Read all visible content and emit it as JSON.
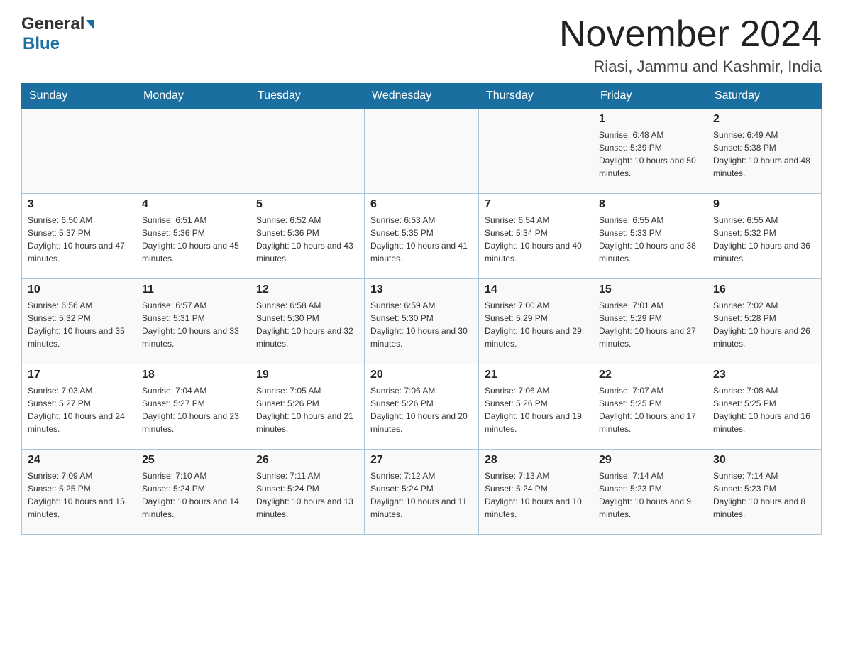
{
  "header": {
    "logo_general": "General",
    "logo_blue": "Blue",
    "month_title": "November 2024",
    "location": "Riasi, Jammu and Kashmir, India"
  },
  "days_of_week": [
    "Sunday",
    "Monday",
    "Tuesday",
    "Wednesday",
    "Thursday",
    "Friday",
    "Saturday"
  ],
  "weeks": [
    [
      {
        "day": "",
        "sunrise": "",
        "sunset": "",
        "daylight": ""
      },
      {
        "day": "",
        "sunrise": "",
        "sunset": "",
        "daylight": ""
      },
      {
        "day": "",
        "sunrise": "",
        "sunset": "",
        "daylight": ""
      },
      {
        "day": "",
        "sunrise": "",
        "sunset": "",
        "daylight": ""
      },
      {
        "day": "",
        "sunrise": "",
        "sunset": "",
        "daylight": ""
      },
      {
        "day": "1",
        "sunrise": "Sunrise: 6:48 AM",
        "sunset": "Sunset: 5:39 PM",
        "daylight": "Daylight: 10 hours and 50 minutes."
      },
      {
        "day": "2",
        "sunrise": "Sunrise: 6:49 AM",
        "sunset": "Sunset: 5:38 PM",
        "daylight": "Daylight: 10 hours and 48 minutes."
      }
    ],
    [
      {
        "day": "3",
        "sunrise": "Sunrise: 6:50 AM",
        "sunset": "Sunset: 5:37 PM",
        "daylight": "Daylight: 10 hours and 47 minutes."
      },
      {
        "day": "4",
        "sunrise": "Sunrise: 6:51 AM",
        "sunset": "Sunset: 5:36 PM",
        "daylight": "Daylight: 10 hours and 45 minutes."
      },
      {
        "day": "5",
        "sunrise": "Sunrise: 6:52 AM",
        "sunset": "Sunset: 5:36 PM",
        "daylight": "Daylight: 10 hours and 43 minutes."
      },
      {
        "day": "6",
        "sunrise": "Sunrise: 6:53 AM",
        "sunset": "Sunset: 5:35 PM",
        "daylight": "Daylight: 10 hours and 41 minutes."
      },
      {
        "day": "7",
        "sunrise": "Sunrise: 6:54 AM",
        "sunset": "Sunset: 5:34 PM",
        "daylight": "Daylight: 10 hours and 40 minutes."
      },
      {
        "day": "8",
        "sunrise": "Sunrise: 6:55 AM",
        "sunset": "Sunset: 5:33 PM",
        "daylight": "Daylight: 10 hours and 38 minutes."
      },
      {
        "day": "9",
        "sunrise": "Sunrise: 6:55 AM",
        "sunset": "Sunset: 5:32 PM",
        "daylight": "Daylight: 10 hours and 36 minutes."
      }
    ],
    [
      {
        "day": "10",
        "sunrise": "Sunrise: 6:56 AM",
        "sunset": "Sunset: 5:32 PM",
        "daylight": "Daylight: 10 hours and 35 minutes."
      },
      {
        "day": "11",
        "sunrise": "Sunrise: 6:57 AM",
        "sunset": "Sunset: 5:31 PM",
        "daylight": "Daylight: 10 hours and 33 minutes."
      },
      {
        "day": "12",
        "sunrise": "Sunrise: 6:58 AM",
        "sunset": "Sunset: 5:30 PM",
        "daylight": "Daylight: 10 hours and 32 minutes."
      },
      {
        "day": "13",
        "sunrise": "Sunrise: 6:59 AM",
        "sunset": "Sunset: 5:30 PM",
        "daylight": "Daylight: 10 hours and 30 minutes."
      },
      {
        "day": "14",
        "sunrise": "Sunrise: 7:00 AM",
        "sunset": "Sunset: 5:29 PM",
        "daylight": "Daylight: 10 hours and 29 minutes."
      },
      {
        "day": "15",
        "sunrise": "Sunrise: 7:01 AM",
        "sunset": "Sunset: 5:29 PM",
        "daylight": "Daylight: 10 hours and 27 minutes."
      },
      {
        "day": "16",
        "sunrise": "Sunrise: 7:02 AM",
        "sunset": "Sunset: 5:28 PM",
        "daylight": "Daylight: 10 hours and 26 minutes."
      }
    ],
    [
      {
        "day": "17",
        "sunrise": "Sunrise: 7:03 AM",
        "sunset": "Sunset: 5:27 PM",
        "daylight": "Daylight: 10 hours and 24 minutes."
      },
      {
        "day": "18",
        "sunrise": "Sunrise: 7:04 AM",
        "sunset": "Sunset: 5:27 PM",
        "daylight": "Daylight: 10 hours and 23 minutes."
      },
      {
        "day": "19",
        "sunrise": "Sunrise: 7:05 AM",
        "sunset": "Sunset: 5:26 PM",
        "daylight": "Daylight: 10 hours and 21 minutes."
      },
      {
        "day": "20",
        "sunrise": "Sunrise: 7:06 AM",
        "sunset": "Sunset: 5:26 PM",
        "daylight": "Daylight: 10 hours and 20 minutes."
      },
      {
        "day": "21",
        "sunrise": "Sunrise: 7:06 AM",
        "sunset": "Sunset: 5:26 PM",
        "daylight": "Daylight: 10 hours and 19 minutes."
      },
      {
        "day": "22",
        "sunrise": "Sunrise: 7:07 AM",
        "sunset": "Sunset: 5:25 PM",
        "daylight": "Daylight: 10 hours and 17 minutes."
      },
      {
        "day": "23",
        "sunrise": "Sunrise: 7:08 AM",
        "sunset": "Sunset: 5:25 PM",
        "daylight": "Daylight: 10 hours and 16 minutes."
      }
    ],
    [
      {
        "day": "24",
        "sunrise": "Sunrise: 7:09 AM",
        "sunset": "Sunset: 5:25 PM",
        "daylight": "Daylight: 10 hours and 15 minutes."
      },
      {
        "day": "25",
        "sunrise": "Sunrise: 7:10 AM",
        "sunset": "Sunset: 5:24 PM",
        "daylight": "Daylight: 10 hours and 14 minutes."
      },
      {
        "day": "26",
        "sunrise": "Sunrise: 7:11 AM",
        "sunset": "Sunset: 5:24 PM",
        "daylight": "Daylight: 10 hours and 13 minutes."
      },
      {
        "day": "27",
        "sunrise": "Sunrise: 7:12 AM",
        "sunset": "Sunset: 5:24 PM",
        "daylight": "Daylight: 10 hours and 11 minutes."
      },
      {
        "day": "28",
        "sunrise": "Sunrise: 7:13 AM",
        "sunset": "Sunset: 5:24 PM",
        "daylight": "Daylight: 10 hours and 10 minutes."
      },
      {
        "day": "29",
        "sunrise": "Sunrise: 7:14 AM",
        "sunset": "Sunset: 5:23 PM",
        "daylight": "Daylight: 10 hours and 9 minutes."
      },
      {
        "day": "30",
        "sunrise": "Sunrise: 7:14 AM",
        "sunset": "Sunset: 5:23 PM",
        "daylight": "Daylight: 10 hours and 8 minutes."
      }
    ]
  ]
}
